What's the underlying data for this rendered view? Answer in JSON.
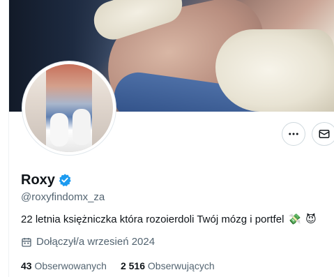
{
  "profile": {
    "name": "Roxy",
    "handle": "@roxyfindomx_za",
    "bio": "22 letnia księżniczka która rozoierdoli Twój mózg i portfel",
    "bio_emojis": [
      "💸",
      "😈"
    ],
    "joined": "Dołączył/a wrzesień 2024",
    "following_count": "43",
    "following_label": "Obserwowanych",
    "followers_count": "2 516",
    "followers_label": "Obserwujących",
    "verified": true
  },
  "actions": {
    "more_icon": "more-horizontal-icon",
    "message_icon": "envelope-icon"
  },
  "colors": {
    "verified_blue": "#1d9bf0",
    "secondary_text": "#536471",
    "primary_text": "#0f1419"
  }
}
